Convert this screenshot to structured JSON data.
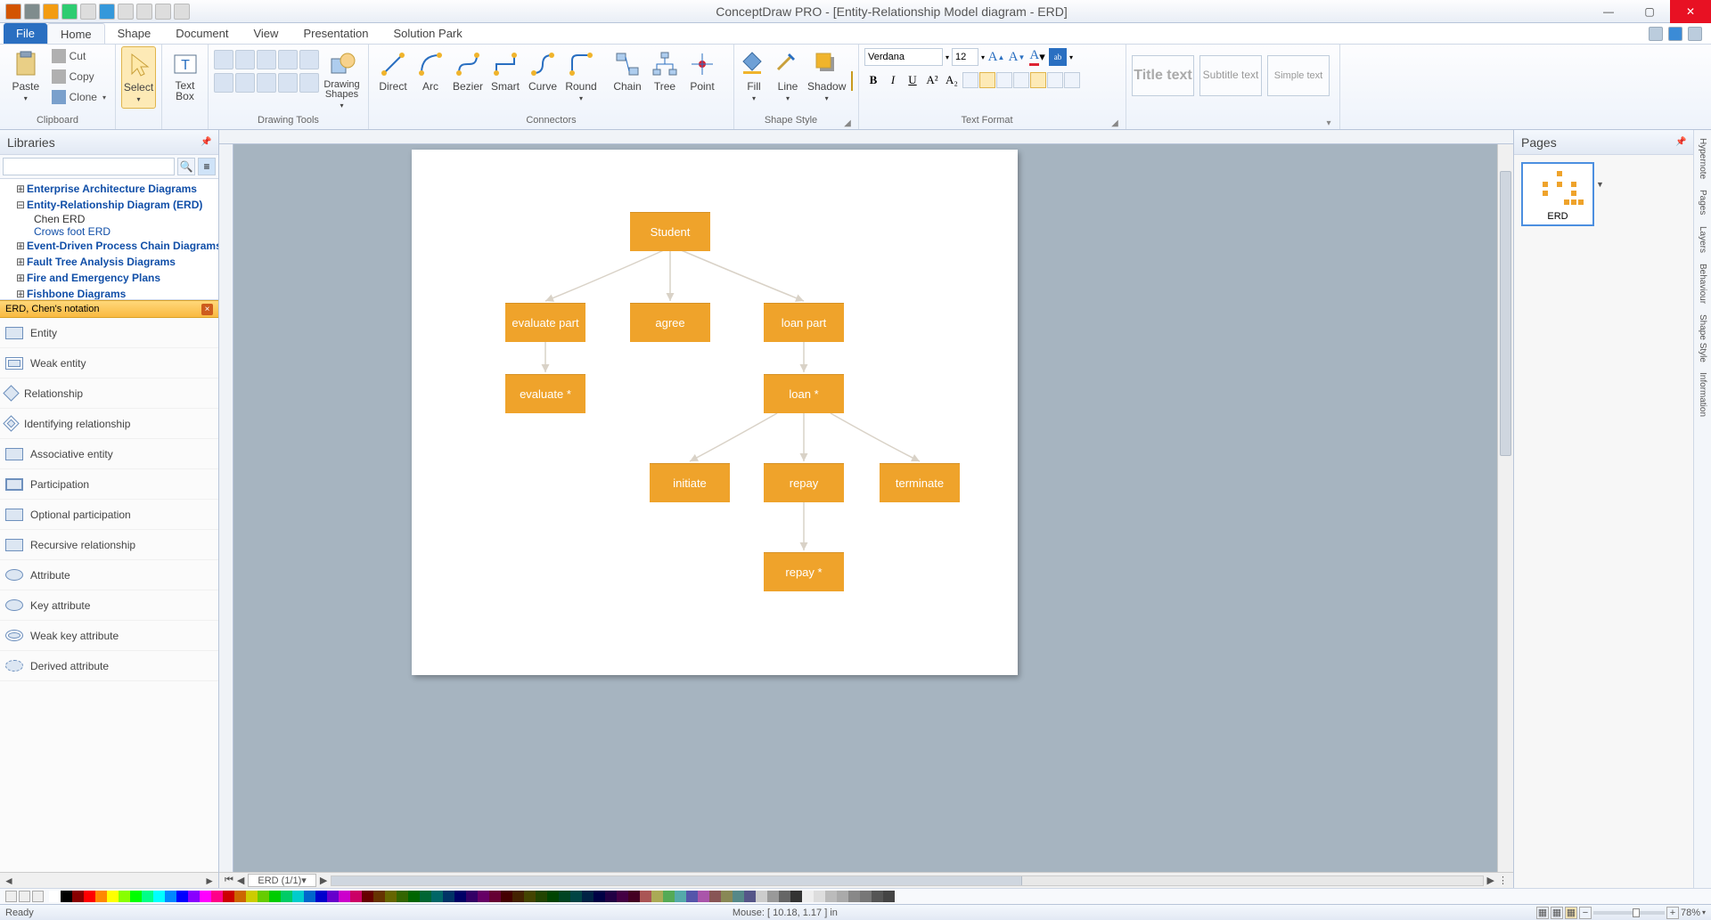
{
  "titlebar": {
    "title": "ConceptDraw PRO - [Entity-Relationship Model diagram - ERD]"
  },
  "menu": {
    "file": "File",
    "tabs": [
      "Home",
      "Shape",
      "Document",
      "View",
      "Presentation",
      "Solution Park"
    ],
    "active": "Home"
  },
  "ribbon": {
    "clipboard": {
      "label": "Clipboard",
      "paste": "Paste",
      "cut": "Cut",
      "copy": "Copy",
      "clone": "Clone"
    },
    "select": "Select",
    "textbox": "Text\nBox",
    "drawingtools": {
      "label": "Drawing Tools",
      "shapes": "Drawing\nShapes"
    },
    "connectors": {
      "label": "Connectors",
      "items": [
        "Direct",
        "Arc",
        "Bezier",
        "Smart",
        "Curve",
        "Round",
        "Chain",
        "Tree",
        "Point"
      ]
    },
    "shapestyle": {
      "label": "Shape Style",
      "fill": "Fill",
      "line": "Line",
      "shadow": "Shadow"
    },
    "textformat": {
      "label": "Text Format",
      "font": "Verdana",
      "size": "12"
    },
    "titletext": "Title text",
    "subtitletext": "Subtitle text",
    "simpletext": "Simple text"
  },
  "libraries": {
    "header": "Libraries",
    "tree": [
      {
        "label": "Enterprise Architecture Diagrams",
        "exp": "+"
      },
      {
        "label": "Entity-Relationship Diagram (ERD)",
        "exp": "–",
        "children": [
          "Chen ERD",
          "Crows foot ERD"
        ]
      },
      {
        "label": "Event-Driven Process Chain Diagrams",
        "exp": "+"
      },
      {
        "label": "Fault Tree Analysis Diagrams",
        "exp": "+"
      },
      {
        "label": "Fire and Emergency Plans",
        "exp": "+"
      },
      {
        "label": "Fishbone Diagrams",
        "exp": "+"
      }
    ],
    "band": "ERD, Chen's notation",
    "shapes": [
      "Entity",
      "Weak entity",
      "Relationship",
      "Identifying relationship",
      "Associative entity",
      "Participation",
      "Optional participation",
      "Recursive relationship",
      "Attribute",
      "Key attribute",
      "Weak key attribute",
      "Derived attribute"
    ]
  },
  "canvas": {
    "sheet_tab": "ERD (1/1)",
    "nodes": {
      "student": "Student",
      "evaluate_part": "evaluate part",
      "agree": "agree",
      "loan_part": "loan part",
      "evaluate_star": "evaluate *",
      "loan_star": "loan *",
      "initiate": "initiate",
      "repay": "repay",
      "terminate": "terminate",
      "repay_star": "repay *"
    }
  },
  "pages": {
    "header": "Pages",
    "thumb": "ERD"
  },
  "rightstrip": [
    "Hypernote",
    "Pages",
    "Layers",
    "Behaviour",
    "Shape Style",
    "Information"
  ],
  "status": {
    "ready": "Ready",
    "mouse": "Mouse: [ 10.18, 1.17 ] in",
    "zoom": "78%"
  },
  "chart_data": {
    "type": "tree",
    "title": "Entity-Relationship Model diagram - ERD",
    "nodes": [
      "Student",
      "evaluate part",
      "agree",
      "loan part",
      "evaluate *",
      "loan *",
      "initiate",
      "repay",
      "terminate",
      "repay *"
    ],
    "edges": [
      [
        "Student",
        "evaluate part"
      ],
      [
        "Student",
        "agree"
      ],
      [
        "Student",
        "loan part"
      ],
      [
        "evaluate part",
        "evaluate *"
      ],
      [
        "loan part",
        "loan *"
      ],
      [
        "loan *",
        "initiate"
      ],
      [
        "loan *",
        "repay"
      ],
      [
        "loan *",
        "terminate"
      ],
      [
        "repay",
        "repay *"
      ]
    ]
  }
}
